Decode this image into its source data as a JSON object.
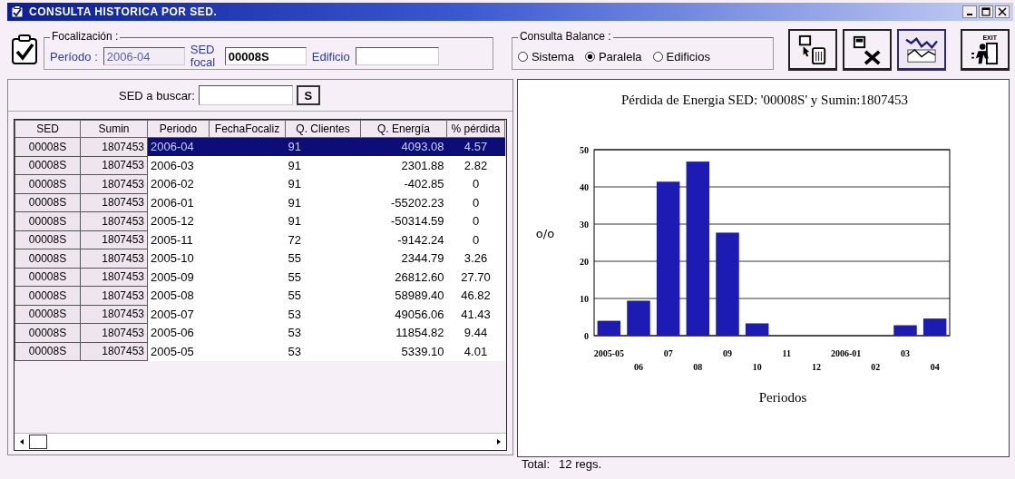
{
  "window": {
    "title": "CONSULTA HISTORICA POR SED."
  },
  "focalizacion": {
    "legend": "Focalización :",
    "periodo": {
      "label": "Período :",
      "value": "2006-04",
      "disabled": true
    },
    "sed_focal": {
      "label": "SED focal",
      "value": "00008S"
    },
    "edificio": {
      "label": "Edificio"
    }
  },
  "consulta_balance": {
    "legend": "Consulta Balance :",
    "options": [
      {
        "label": "Sistema",
        "selected": false
      },
      {
        "label": "Paralela",
        "selected": true
      },
      {
        "label": "Edificios",
        "selected": false
      }
    ]
  },
  "toolbar": [
    {
      "kind": "monitor-trash",
      "pressed": false
    },
    {
      "kind": "excel",
      "pressed": false
    },
    {
      "kind": "chart",
      "pressed": true
    },
    {
      "kind": "exit",
      "label": "EXIT",
      "pressed": false
    }
  ],
  "search": {
    "label": "SED a buscar:",
    "button": "S"
  },
  "table": {
    "columns": [
      "SED",
      "Sumin",
      "Periodo",
      "FechaFocaliz",
      "Q. Clientes",
      "Q. Energía",
      "% pérdida"
    ],
    "rows": [
      {
        "cells": [
          "00008S",
          "1807453",
          "2006-04",
          null,
          "91",
          "4093.08",
          "4.57"
        ],
        "selected": true
      },
      {
        "cells": [
          "00008S",
          "1807453",
          "2006-03",
          null,
          "91",
          "2301.88",
          "2.82"
        ],
        "selected": false
      },
      {
        "cells": [
          "00008S",
          "1807453",
          "2006-02",
          null,
          "91",
          "-402.85",
          "0"
        ],
        "selected": false
      },
      {
        "cells": [
          "00008S",
          "1807453",
          "2006-01",
          null,
          "91",
          "-55202.23",
          "0"
        ],
        "selected": false
      },
      {
        "cells": [
          "00008S",
          "1807453",
          "2005-12",
          null,
          "91",
          "-50314.59",
          "0"
        ],
        "selected": false
      },
      {
        "cells": [
          "00008S",
          "1807453",
          "2005-11",
          null,
          "72",
          "-9142.24",
          "0"
        ],
        "selected": false
      },
      {
        "cells": [
          "00008S",
          "1807453",
          "2005-10",
          null,
          "55",
          "2344.79",
          "3.26"
        ],
        "selected": false
      },
      {
        "cells": [
          "00008S",
          "1807453",
          "2005-09",
          null,
          "55",
          "26812.60",
          "27.70"
        ],
        "selected": false
      },
      {
        "cells": [
          "00008S",
          "1807453",
          "2005-08",
          null,
          "55",
          "58989.40",
          "46.82"
        ],
        "selected": false
      },
      {
        "cells": [
          "00008S",
          "1807453",
          "2005-07",
          null,
          "53",
          "49056.06",
          "41.43"
        ],
        "selected": false
      },
      {
        "cells": [
          "00008S",
          "1807453",
          "2005-06",
          null,
          "53",
          "11854.82",
          "9.44"
        ],
        "selected": false
      },
      {
        "cells": [
          "00008S",
          "1807453",
          "2005-05",
          null,
          "53",
          "5339.10",
          "4.01"
        ],
        "selected": false
      }
    ]
  },
  "chart": {
    "chart_data": {
      "type": "bar",
      "title": "Pérdida de Energia SED: '00008S' y Sumin:1807453",
      "xlabel": "Periodos",
      "ylabel": "o/o",
      "categories": [
        "2005-05",
        "06",
        "07",
        "08",
        "09",
        "10",
        "11",
        "12",
        "2006-01",
        "02",
        "03",
        "04"
      ],
      "series": [
        {
          "color": "#1c1cb4",
          "values": [
            4.0,
            9.4,
            41.4,
            46.8,
            27.7,
            3.3,
            0,
            0,
            0,
            0,
            2.8,
            4.6
          ]
        }
      ],
      "ylim": [
        0,
        50
      ],
      "yticks": [
        0,
        10,
        20,
        30,
        40,
        50
      ],
      "grid": true
    }
  },
  "status_bar": {
    "label": "Total:",
    "value": "12 regs."
  }
}
